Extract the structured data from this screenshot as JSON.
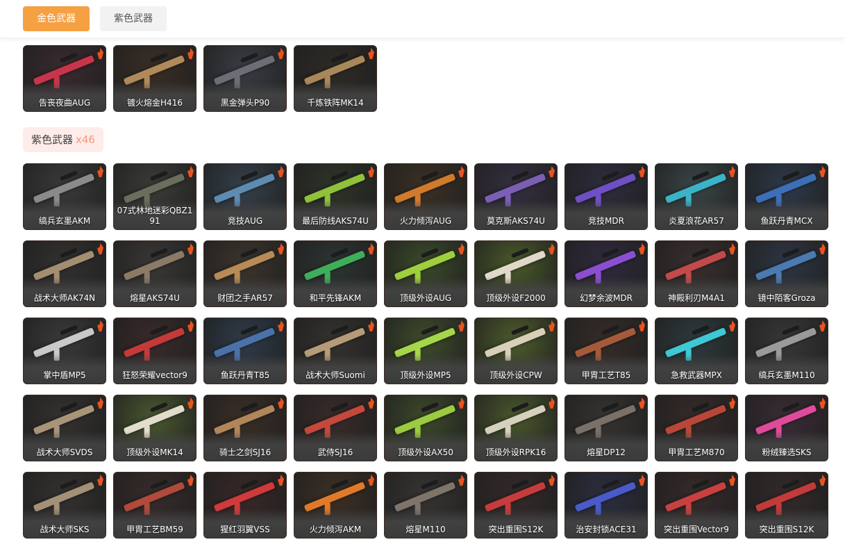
{
  "tabs": {
    "gold_label": "金色武器",
    "purple_label": "紫色武器"
  },
  "purple_section": {
    "title": "紫色武器",
    "count": "x46"
  },
  "gold_items": [
    {
      "name": "告丧夜曲AUG",
      "gun": "#c8354a",
      "bg": "#3b2a30"
    },
    {
      "name": "镀火熔金H416",
      "gun": "#b08a5a",
      "bg": "#3a2e25"
    },
    {
      "name": "黑金弹头P90",
      "gun": "#6b6f75",
      "bg": "#3a3d44"
    },
    {
      "name": "千炼铁阵MK14",
      "gun": "#a8875a",
      "bg": "#2f2a26"
    }
  ],
  "purple_items": [
    {
      "name": "缟兵玄墨AKM",
      "gun": "#8a8a8a",
      "bg": "#3a3a3a"
    },
    {
      "name": "07式林地迷彩QBZ191",
      "gun": "#6b6e5c",
      "bg": "#3b3b38"
    },
    {
      "name": "竞技AUG",
      "gun": "#5e8bb0",
      "bg": "#35414b"
    },
    {
      "name": "最后防线AKS74U",
      "gun": "#8fc13a",
      "bg": "#2e3428"
    },
    {
      "name": "火力倾泻AUG",
      "gun": "#d07a2c",
      "bg": "#3b3025"
    },
    {
      "name": "莫克斯AKS74U",
      "gun": "#7a5fb4",
      "bg": "#352f40"
    },
    {
      "name": "竞技MDR",
      "gun": "#6f4fc4",
      "bg": "#2f2c3e"
    },
    {
      "name": "炎夏浪花AR57",
      "gun": "#3bb3c6",
      "bg": "#3a4648"
    },
    {
      "name": "鱼跃丹青MCX",
      "gun": "#3d6fb8",
      "bg": "#2e3a4a"
    },
    {
      "name": "战术大师AK74N",
      "gun": "#a38e70",
      "bg": "#333130"
    },
    {
      "name": "熔星AKS74U",
      "gun": "#8a7a66",
      "bg": "#3a3836"
    },
    {
      "name": "财团之手AR57",
      "gun": "#b88a55",
      "bg": "#3b342c"
    },
    {
      "name": "和平先锋AKM",
      "gun": "#3fae5a",
      "bg": "#2c3531"
    },
    {
      "name": "顶级外设AUG",
      "gun": "#9fcf3c",
      "bg": "#3b4a2a"
    },
    {
      "name": "顶级外设F2000",
      "gun": "#e0d8c8",
      "bg": "#4a5a2a"
    },
    {
      "name": "幻梦余波MDR",
      "gun": "#8a4fd0",
      "bg": "#302a3e"
    },
    {
      "name": "神殿利刃M4A1",
      "gun": "#c24a4a",
      "bg": "#3a2e2e"
    },
    {
      "name": "镜中陌客Groza",
      "gun": "#4a7ab0",
      "bg": "#2e3644"
    },
    {
      "name": "掌中盾MP5",
      "gun": "#c9c9c9",
      "bg": "#3a3a3a"
    },
    {
      "name": "狂怒荣耀vector9",
      "gun": "#c23a3a",
      "bg": "#3a2a2a"
    },
    {
      "name": "鱼跃丹青T85",
      "gun": "#4a72a8",
      "bg": "#2f3b4a"
    },
    {
      "name": "战术大师Suomi",
      "gun": "#b59b78",
      "bg": "#35322e"
    },
    {
      "name": "顶级外设MP5",
      "gun": "#a6d64a",
      "bg": "#3e4c2c"
    },
    {
      "name": "顶级外设CPW",
      "gun": "#d8d0b8",
      "bg": "#4e5c2c"
    },
    {
      "name": "甲胄工艺T85",
      "gun": "#a55a3a",
      "bg": "#352c28"
    },
    {
      "name": "急救武器MPX",
      "gun": "#3ec8d4",
      "bg": "#2e3a3c"
    },
    {
      "name": "缟兵玄墨M110",
      "gun": "#9a9a9a",
      "bg": "#383838"
    },
    {
      "name": "战术大师SVDS",
      "gun": "#a89478",
      "bg": "#343230"
    },
    {
      "name": "顶级外设MK14",
      "gun": "#e2dccc",
      "bg": "#4a5830"
    },
    {
      "name": "骑士之剑SJ16",
      "gun": "#b0865a",
      "bg": "#3a2e26"
    },
    {
      "name": "武侍SJ16",
      "gun": "#c4483c",
      "bg": "#382c2a"
    },
    {
      "name": "顶级外设AX50",
      "gun": "#9ccb40",
      "bg": "#3c4a2a"
    },
    {
      "name": "顶级外设RPK16",
      "gun": "#d6d0be",
      "bg": "#4a582c"
    },
    {
      "name": "熔星DP12",
      "gun": "#7a7068",
      "bg": "#363432"
    },
    {
      "name": "甲胄工艺M870",
      "gun": "#b8473a",
      "bg": "#352b29"
    },
    {
      "name": "粉绒臻选SKS",
      "gun": "#e04a9a",
      "bg": "#3a2c36"
    },
    {
      "name": "战术大师SKS",
      "gun": "#a49076",
      "bg": "#343230"
    },
    {
      "name": "甲胄工艺BM59",
      "gun": "#b04a3a",
      "bg": "#362c2a"
    },
    {
      "name": "猩红羽翼VSS",
      "gun": "#d03a3a",
      "bg": "#3a2828"
    },
    {
      "name": "火力倾泻AKM",
      "gun": "#e07a2a",
      "bg": "#3c3026"
    },
    {
      "name": "熔星M110",
      "gun": "#7e746a",
      "bg": "#373533"
    },
    {
      "name": "突出重围S12K",
      "gun": "#c63c3c",
      "bg": "#342a2a"
    },
    {
      "name": "治安封锁ACE31",
      "gun": "#4a5ac8",
      "bg": "#2c2e40"
    },
    {
      "name": "突出重围Vector9",
      "gun": "#c84040",
      "bg": "#362a2a"
    },
    {
      "name": "突出重围S12K",
      "gun": "#c23a3a",
      "bg": "#342a2a"
    }
  ]
}
